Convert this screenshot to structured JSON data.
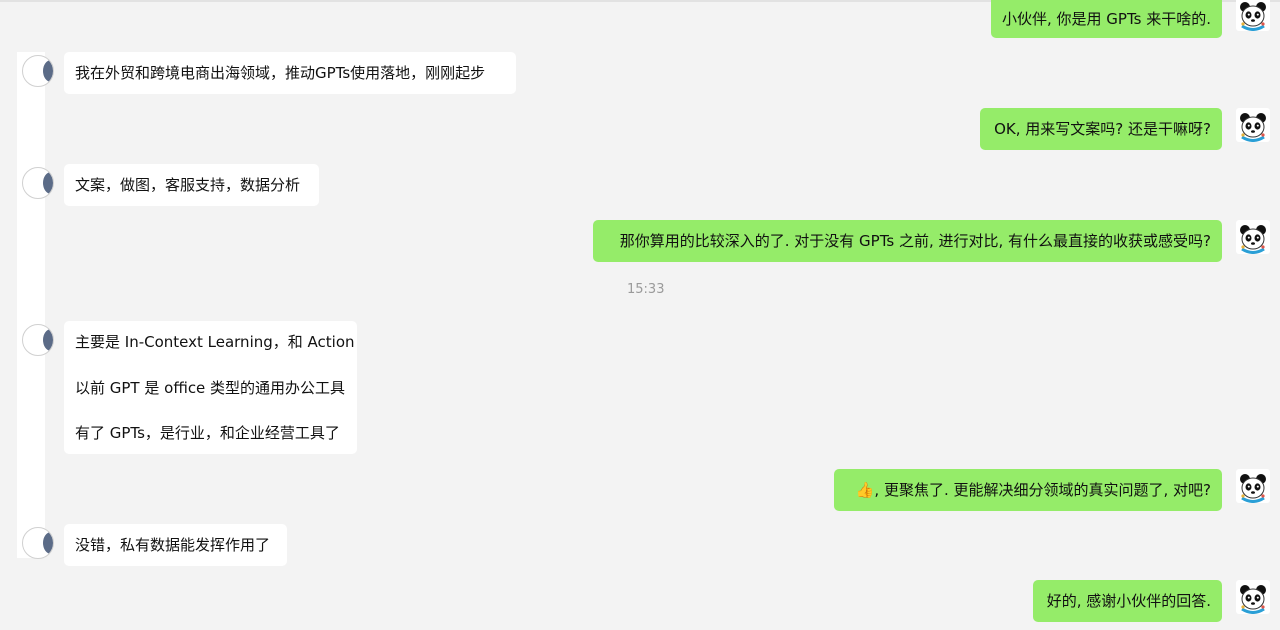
{
  "conversation": {
    "timestamp": "15:33",
    "messages": [
      {
        "side": "me",
        "text": "小伙伴, 你是用 GPTs 来干啥的."
      },
      {
        "side": "peer",
        "text": "我在外贸和跨境电商出海领域，推动GPTs使用落地，刚刚起步"
      },
      {
        "side": "me",
        "text": "OK, 用来写文案吗? 还是干嘛呀?"
      },
      {
        "side": "peer",
        "text": "文案，做图，客服支持，数据分析"
      },
      {
        "side": "me",
        "text": "那你算用的比较深入的了. 对于没有 GPTs 之前, 进行对比, 有什么最直接的收获或感受吗?"
      },
      {
        "side": "peer",
        "lines": [
          "主要是 In-Context Learning，和 Action",
          "以前 GPT 是 office 类型的通用办公工具",
          "有了 GPTs，是行业，和企业经营工具了"
        ]
      },
      {
        "side": "me",
        "text": "👍, 更聚焦了. 更能解决细分领域的真实问题了, 对吧?"
      },
      {
        "side": "peer",
        "text": "没错，私有数据能发挥作用了"
      },
      {
        "side": "me",
        "text": "好的, 感谢小伙伴的回答."
      }
    ]
  },
  "colors": {
    "background": "#f3f3f3",
    "me_bubble": "#95ec69",
    "peer_bubble": "#ffffff",
    "timestamp": "#9a9a9a"
  },
  "icons": {
    "me_avatar": "panda-avatar-icon",
    "peer_avatar": "user-avatar-icon"
  }
}
